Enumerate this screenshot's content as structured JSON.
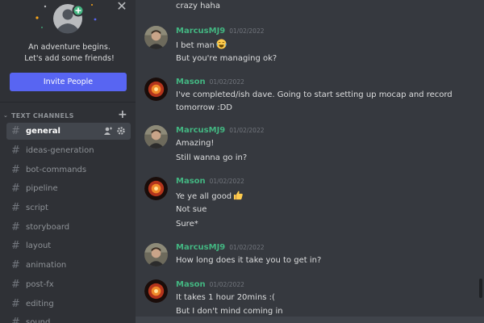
{
  "sidebar": {
    "invite": {
      "line1": "An adventure begins.",
      "line2": "Let's add some friends!",
      "button_label": "Invite People"
    },
    "category": "TEXT CHANNELS",
    "channels": [
      {
        "name": "general"
      },
      {
        "name": "ideas-generation"
      },
      {
        "name": "bot-commands"
      },
      {
        "name": "pipeline"
      },
      {
        "name": "script"
      },
      {
        "name": "storyboard"
      },
      {
        "name": "layout"
      },
      {
        "name": "animation"
      },
      {
        "name": "post-fx"
      },
      {
        "name": "editing"
      },
      {
        "name": "sound"
      }
    ],
    "active_channel": "general"
  },
  "chat": {
    "prev_tail": "crazy haha",
    "messages": [
      {
        "author": "MarcusMJ9",
        "timestamp": "01/02/2022",
        "lines": [
          "I bet man",
          "But you're managing ok?"
        ],
        "emoji": "joy"
      },
      {
        "author": "Mason",
        "timestamp": "01/02/2022",
        "lines": [
          "I've completed/ish dave. Going to start setting up mocap and record",
          "tomorrow :DD"
        ]
      },
      {
        "author": "MarcusMJ9",
        "timestamp": "01/02/2022",
        "lines": [
          "Amazing!",
          "Still wanna go in?"
        ]
      },
      {
        "author": "Mason",
        "timestamp": "01/02/2022",
        "lines": [
          "Ye ye all good",
          "Not sue",
          "Sure*"
        ],
        "emoji": "thumbs-up"
      },
      {
        "author": "MarcusMJ9",
        "timestamp": "01/02/2022",
        "lines": [
          "How long does it take you to get in?"
        ]
      },
      {
        "author": "Mason",
        "timestamp": "01/02/2022",
        "lines": [
          "It takes 1 hour 20mins :(",
          "But I don't mind coming in"
        ]
      }
    ]
  },
  "colors": {
    "accent": "#5865f2",
    "author": "#43b581",
    "sidebar_bg": "#2f3136",
    "chat_bg": "#36393f"
  },
  "icons": [
    "close-icon",
    "add-friends-illustration",
    "chevron-down-icon",
    "plus-icon",
    "hash-icon",
    "add-member-icon",
    "gear-icon",
    "joy-emoji-icon",
    "thumbs-up-emoji-icon"
  ]
}
